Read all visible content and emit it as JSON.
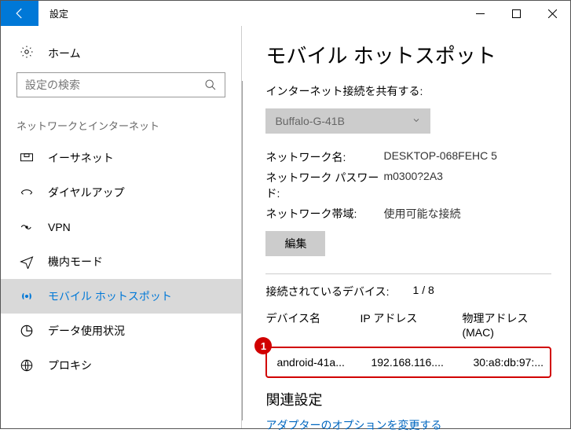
{
  "window": {
    "title": "設定"
  },
  "sidebar": {
    "home": "ホーム",
    "search_placeholder": "設定の検索",
    "category": "ネットワークとインターネット",
    "items": [
      {
        "label": "イーサネット"
      },
      {
        "label": "ダイヤルアップ"
      },
      {
        "label": "VPN"
      },
      {
        "label": "機内モード"
      },
      {
        "label": "モバイル ホットスポット"
      },
      {
        "label": "データ使用状況"
      },
      {
        "label": "プロキシ"
      }
    ]
  },
  "main": {
    "title": "モバイル ホットスポット",
    "share_label": "インターネット接続を共有する:",
    "adapter": "Buffalo-G-41B",
    "net_name_label": "ネットワーク名:",
    "net_name": "DESKTOP-068FEHC 5",
    "net_pwd_label": "ネットワーク パスワード:",
    "net_pwd": "m0300?2A3",
    "net_band_label": "ネットワーク帯域:",
    "net_band": "使用可能な接続",
    "edit": "編集",
    "connected_label": "接続されているデバイス:",
    "connected_count": "1 / 8",
    "col_device": "デバイス名",
    "col_ip": "IP アドレス",
    "col_mac": "物理アドレス (MAC)",
    "row": {
      "device": "android-41a...",
      "ip": "192.168.116....",
      "mac": "30:a8:db:97:..."
    },
    "callout": "1",
    "related_title": "関連設定",
    "related_link": "アダプターのオプションを変更する"
  }
}
